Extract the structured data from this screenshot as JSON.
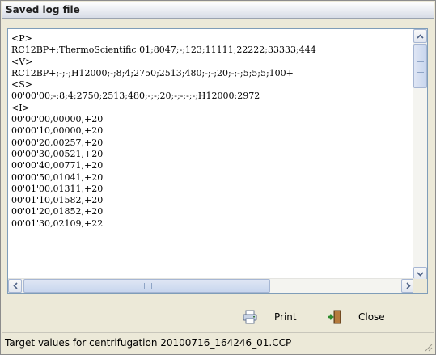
{
  "window": {
    "title": "Saved log file"
  },
  "log": {
    "lines": [
      "<P>",
      "RC12BP+;ThermoScientific 01;8047;-;123;11111;22222;33333;444",
      "<V>",
      "RC12BP+;-;-;H12000;-;8;4;2750;2513;480;-;-;20;-;-;5;5;5;100+",
      "<S>",
      "00'00'00;-;8;4;2750;2513;480;-;-;20;-;-;-;-;H12000;2972",
      "<I>",
      "00'00'00,00000,+20",
      "00'00'10,00000,+20",
      "00'00'20,00257,+20",
      "00'00'30,00521,+20",
      "00'00'40,00771,+20",
      "00'00'50,01041,+20",
      "00'01'00,01311,+20",
      "00'01'10,01582,+20",
      "00'01'20,01852,+20",
      "00'01'30,02109,+22"
    ]
  },
  "buttons": {
    "print_label": "Print",
    "close_label": "Close"
  },
  "status": {
    "text": "Target values for centrifugation 20100716_164246_01.CCP"
  },
  "icons": {
    "print": "printer-icon",
    "close": "exit-door-icon"
  },
  "colors": {
    "border": "#7f9db9",
    "scroll_accent": "#a6b6d3"
  }
}
